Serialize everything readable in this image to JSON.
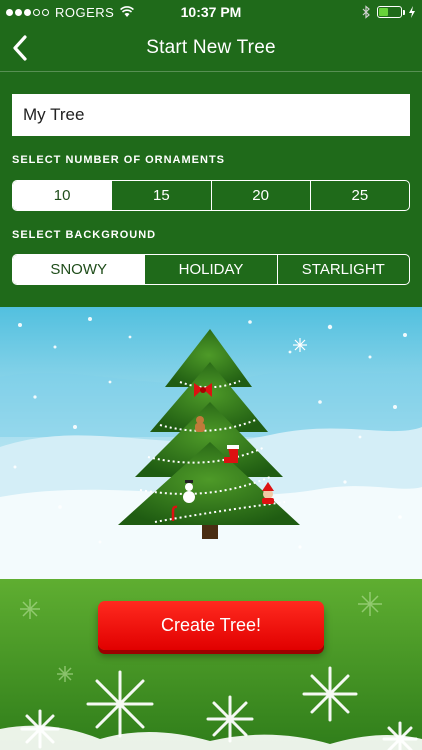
{
  "status_bar": {
    "carrier": "ROGERS",
    "time": "10:37 PM",
    "signal_bars": 3,
    "battery_level": 0.45,
    "battery_color": "#67d33a"
  },
  "nav": {
    "back_icon": "chevron-left-icon",
    "title": "Start New Tree"
  },
  "tree_name": {
    "value": "My Tree"
  },
  "ornaments": {
    "label": "SELECT NUMBER OF ORNAMENTS",
    "options": [
      "10",
      "15",
      "20",
      "25"
    ],
    "selected": "10"
  },
  "background": {
    "label": "SELECT BACKGROUND",
    "options": [
      "SNOWY",
      "HOLIDAY",
      "STARLIGHT"
    ],
    "selected": "SNOWY"
  },
  "preview": {
    "ornament_icons": [
      "bow-icon",
      "gingerbread-icon",
      "stocking-icon",
      "snowman-icon",
      "santa-icon",
      "candy-cane-icon"
    ]
  },
  "actions": {
    "create_label": "Create Tree!"
  },
  "colors": {
    "header_green": "#1f6a1a",
    "button_red": "#ff1a10",
    "sky": "#bfe6f2"
  }
}
